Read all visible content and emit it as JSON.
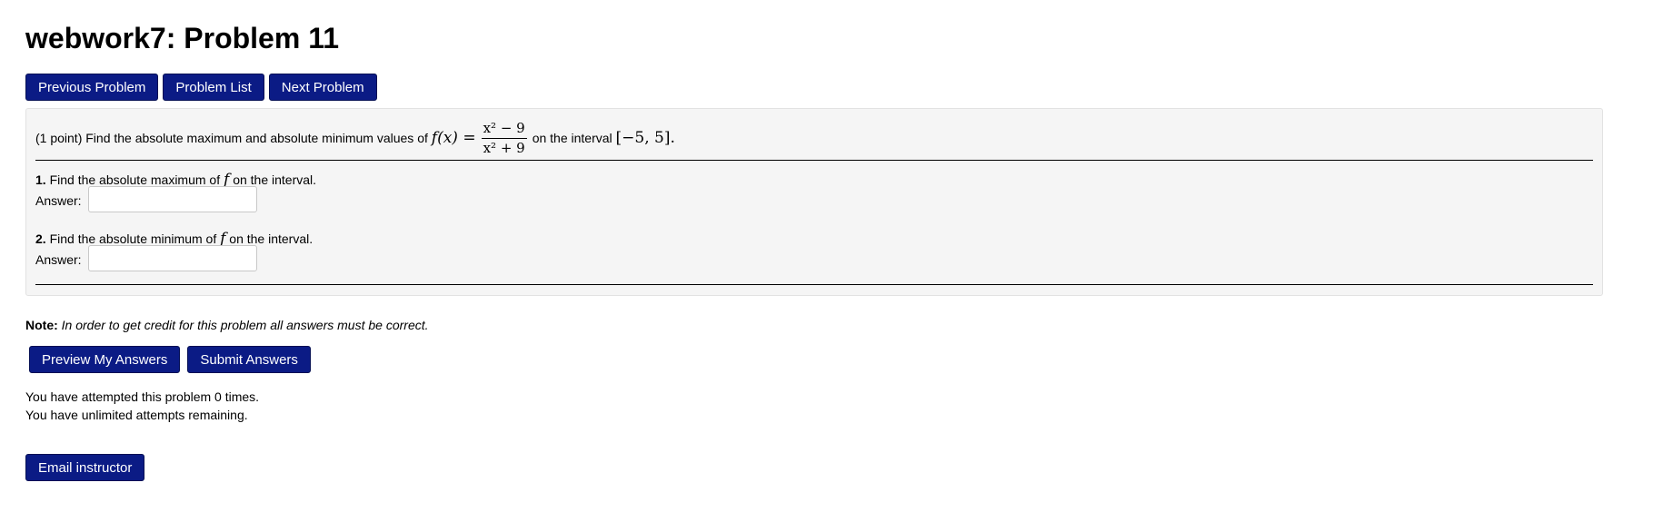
{
  "page": {
    "title": "webwork7: Problem 11"
  },
  "nav": {
    "previous_label": "Previous Problem",
    "list_label": "Problem List",
    "next_label": "Next Problem"
  },
  "problem": {
    "points": "(1 point)",
    "statement_pre": "Find the absolute maximum and absolute minimum values of",
    "function_lhs": "f(x) =",
    "fraction_numerator": "x² − 9",
    "fraction_denominator": "x² + 9",
    "statement_mid": "on the interval",
    "interval": "[−5, 5].",
    "questions": [
      {
        "number": "1.",
        "text_pre": "Find the absolute maximum of",
        "symbol": "f",
        "text_post": "on the interval.",
        "answer_label": "Answer:",
        "answer_value": ""
      },
      {
        "number": "2.",
        "text_pre": "Find the absolute minimum of",
        "symbol": "f",
        "text_post": "on the interval.",
        "answer_label": "Answer:",
        "answer_value": ""
      }
    ]
  },
  "note": {
    "label": "Note:",
    "text": "In order to get credit for this problem all answers must be correct."
  },
  "actions": {
    "preview_label": "Preview My Answers",
    "submit_label": "Submit Answers"
  },
  "attempts": {
    "line1": "You have attempted this problem 0 times.",
    "line2": "You have unlimited attempts remaining."
  },
  "email": {
    "label": "Email instructor"
  },
  "colors": {
    "button_bg": "#0b1b85",
    "panel_bg": "#f5f5f5"
  }
}
